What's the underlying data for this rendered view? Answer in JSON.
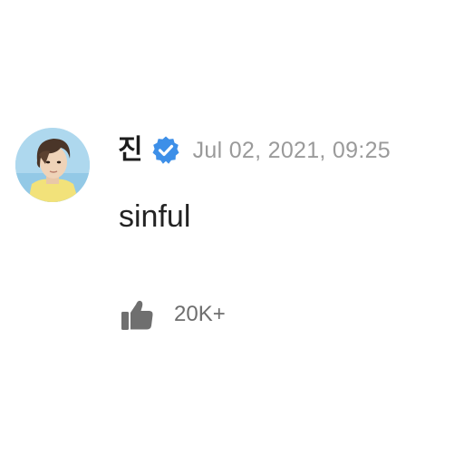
{
  "comment": {
    "author": {
      "name": "진",
      "verified": true,
      "avatar_icon": "profile-photo-avatar",
      "verified_icon": "verified-badge-icon",
      "verified_color": "#3d8fe8"
    },
    "timestamp": "Jul 02, 2021, 09:25",
    "text": "sinful",
    "likes": {
      "icon": "thumbs-up-icon",
      "count_label": "20K+"
    }
  }
}
